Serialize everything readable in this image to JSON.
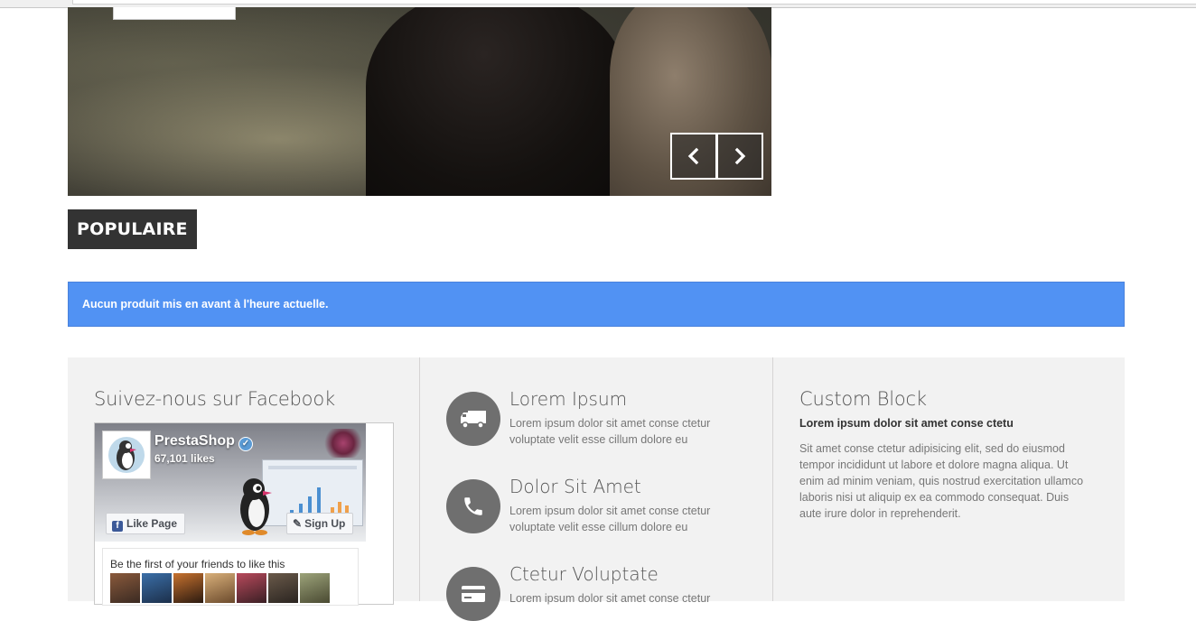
{
  "slider": {
    "prev_icon": "chevron-left-icon",
    "next_icon": "chevron-right-icon"
  },
  "popular": {
    "heading": "POPULAIRE",
    "alert_text": "Aucun produit mis en avant à l'heure actuelle."
  },
  "footer": {
    "facebook": {
      "title": "Suivez-nous sur Facebook",
      "page_name": "PrestaShop",
      "likes": "67,101 likes",
      "like_button": "Like Page",
      "signup_button": "Sign Up",
      "friends_text": "Be the first of your friends to like this"
    },
    "features": [
      {
        "icon": "truck-icon",
        "title": "Lorem Ipsum",
        "text": "Lorem ipsum dolor sit amet conse ctetur voluptate velit esse cillum dolore eu"
      },
      {
        "icon": "phone-icon",
        "title": "Dolor Sit Amet",
        "text": "Lorem ipsum dolor sit amet conse ctetur voluptate velit esse cillum dolore eu"
      },
      {
        "icon": "credit-card-icon",
        "title": "Ctetur Voluptate",
        "text": "Lorem ipsum dolor sit amet conse ctetur"
      }
    ],
    "custom_block": {
      "title": "Custom Block",
      "subtitle": "Lorem ipsum dolor sit amet conse ctetu",
      "text": "Sit amet conse ctetur adipisicing elit, sed do eiusmod tempor incididunt ut labore et dolore magna aliqua. Ut enim ad minim veniam, quis nostrud exercitation ullamco laboris nisi ut aliquip ex ea commodo consequat. Duis aute irure dolor in reprehenderit."
    }
  },
  "colors": {
    "alert_bg": "#5192f3",
    "heading_bg": "#333333",
    "footer_bg": "#f2f2f2",
    "icon_circle": "#6f6f6f"
  }
}
